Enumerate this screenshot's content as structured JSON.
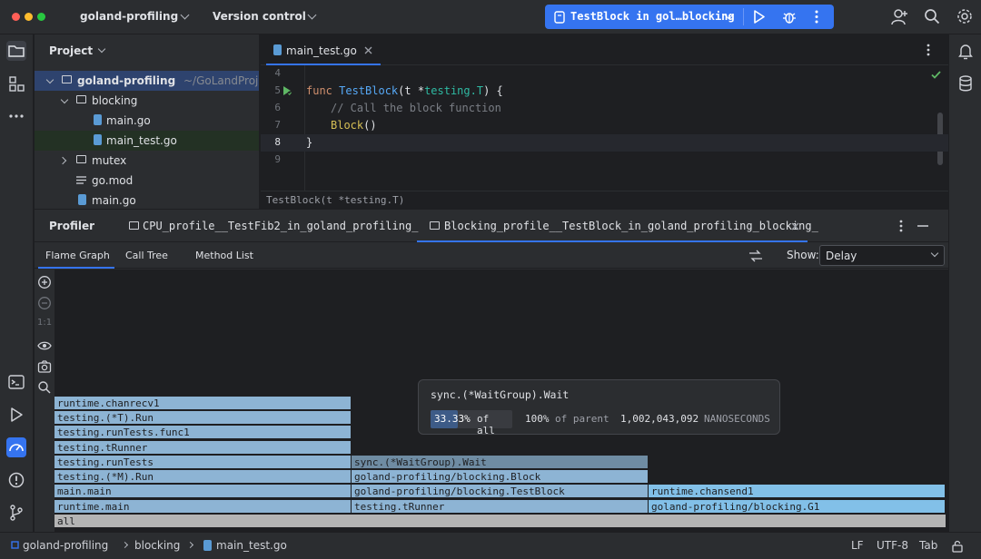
{
  "titlebar": {
    "project": "goland-profiling",
    "vcs": "Version control",
    "run_config": "TestBlock in gol…blocking"
  },
  "project_panel": {
    "title": "Project",
    "items": [
      {
        "label": "goland-profiling",
        "path": "~/GoLandProje",
        "kind": "folder"
      },
      {
        "label": "blocking",
        "kind": "folder"
      },
      {
        "label": "main.go",
        "kind": "gofile"
      },
      {
        "label": "main_test.go",
        "kind": "gofile"
      },
      {
        "label": "mutex",
        "kind": "folder"
      },
      {
        "label": "go.mod",
        "kind": "modfile"
      },
      {
        "label": "main.go",
        "kind": "gofile"
      }
    ]
  },
  "editor": {
    "tab": "main_test.go",
    "lines": [
      {
        "num": "4"
      },
      {
        "num": "5"
      },
      {
        "num": "6"
      },
      {
        "num": "7"
      },
      {
        "num": "8"
      },
      {
        "num": "9"
      }
    ],
    "code": {
      "l5_kw": "func ",
      "l5_fn": "TestBlock",
      "l5_p1": "(t *",
      "l5_ty": "testing.T",
      "l5_p2": ") {",
      "l6": "// Call the block function",
      "l7_call": "Block",
      "l7_rest": "()",
      "l8": "}"
    },
    "breadcrumb": "TestBlock(t *testing.T)"
  },
  "profiler": {
    "title": "Profiler",
    "tabs": [
      "CPU_profile__TestFib2_in_goland_profiling_",
      "Blocking_profile__TestBlock_in_goland_profiling_blocking_"
    ],
    "subtabs": [
      "Flame Graph",
      "Call Tree",
      "Method List"
    ],
    "show_label": "Show:",
    "show_value": "Delay",
    "tools": {
      "zoom_reset": "1:1"
    }
  },
  "flame": {
    "col1": [
      "runtime.chanrecv1",
      "testing.(*T).Run",
      "testing.runTests.func1",
      "testing.tRunner",
      "testing.runTests",
      "testing.(*M).Run",
      "main.main",
      "runtime.main"
    ],
    "col2": [
      "sync.(*WaitGroup).Wait",
      "goland-profiling/blocking.Block",
      "goland-profiling/blocking.TestBlock",
      "testing.tRunner"
    ],
    "col3": [
      "runtime.chansend1",
      "goland-profiling/blocking.G1"
    ],
    "root": "all"
  },
  "tooltip": {
    "title": "sync.(*WaitGroup).Wait",
    "percent_all": "33.33%",
    "of_all": "of all",
    "percent_parent": "100%",
    "of_parent": "of parent",
    "value": "1,002,043,092",
    "unit": "NANOSECONDS",
    "fraction_all": 0.3333
  },
  "statusbar": {
    "crumbs": [
      "goland-profiling",
      "blocking",
      "main_test.go"
    ],
    "line_sep": "LF",
    "encoding": "UTF-8",
    "indent": "Tab"
  },
  "colors": {
    "accent": "#3574f0",
    "flame": "#8db4d4",
    "flame_selected": "#6f8ca3"
  }
}
